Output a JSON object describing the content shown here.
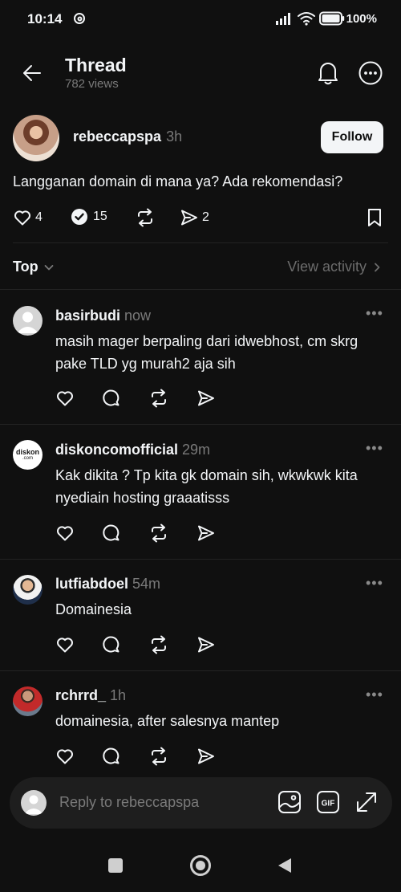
{
  "status": {
    "time": "10:14",
    "battery": "100%"
  },
  "header": {
    "title": "Thread",
    "views": "782 views"
  },
  "post": {
    "author": "rebeccapspa",
    "time": "3h",
    "follow_label": "Follow",
    "text": "Langganan domain di mana ya? Ada rekomendasi?",
    "likes": "4",
    "replies": "15",
    "shares": "2"
  },
  "sort": {
    "label": "Top",
    "view_activity": "View activity"
  },
  "replies": [
    {
      "user": "basirbudi",
      "time": "now",
      "text": "masih mager berpaling dari idwebhost, cm skrg pake TLD yg murah2 aja sih"
    },
    {
      "user": "diskoncomofficial",
      "time": "29m",
      "text": "Kak dikita ? Tp kita gk domain sih, wkwkwk kita nyediain hosting graaatisss",
      "avatar_text": "diskon",
      "avatar_sub": ".com"
    },
    {
      "user": "lutfiabdoel",
      "time": "54m",
      "text": "Domainesia"
    },
    {
      "user": "rchrrd_",
      "time": "1h",
      "text": "domainesia, after salesnya mantep"
    }
  ],
  "composer": {
    "placeholder": "Reply to rebeccapspa"
  },
  "colors": {
    "background": "#101010",
    "text": "#f3f5f7",
    "muted": "#7a7a7a",
    "divider": "#232323"
  },
  "icons": [
    "back-arrow-icon",
    "bell-icon",
    "more-circle-icon",
    "heart-icon",
    "verified-reply-icon",
    "repost-icon",
    "send-icon",
    "bookmark-icon",
    "chevron-down-icon",
    "chevron-right-icon",
    "image-icon",
    "gif-icon",
    "expand-icon",
    "nav-square-icon",
    "nav-circle-icon",
    "nav-back-icon"
  ]
}
